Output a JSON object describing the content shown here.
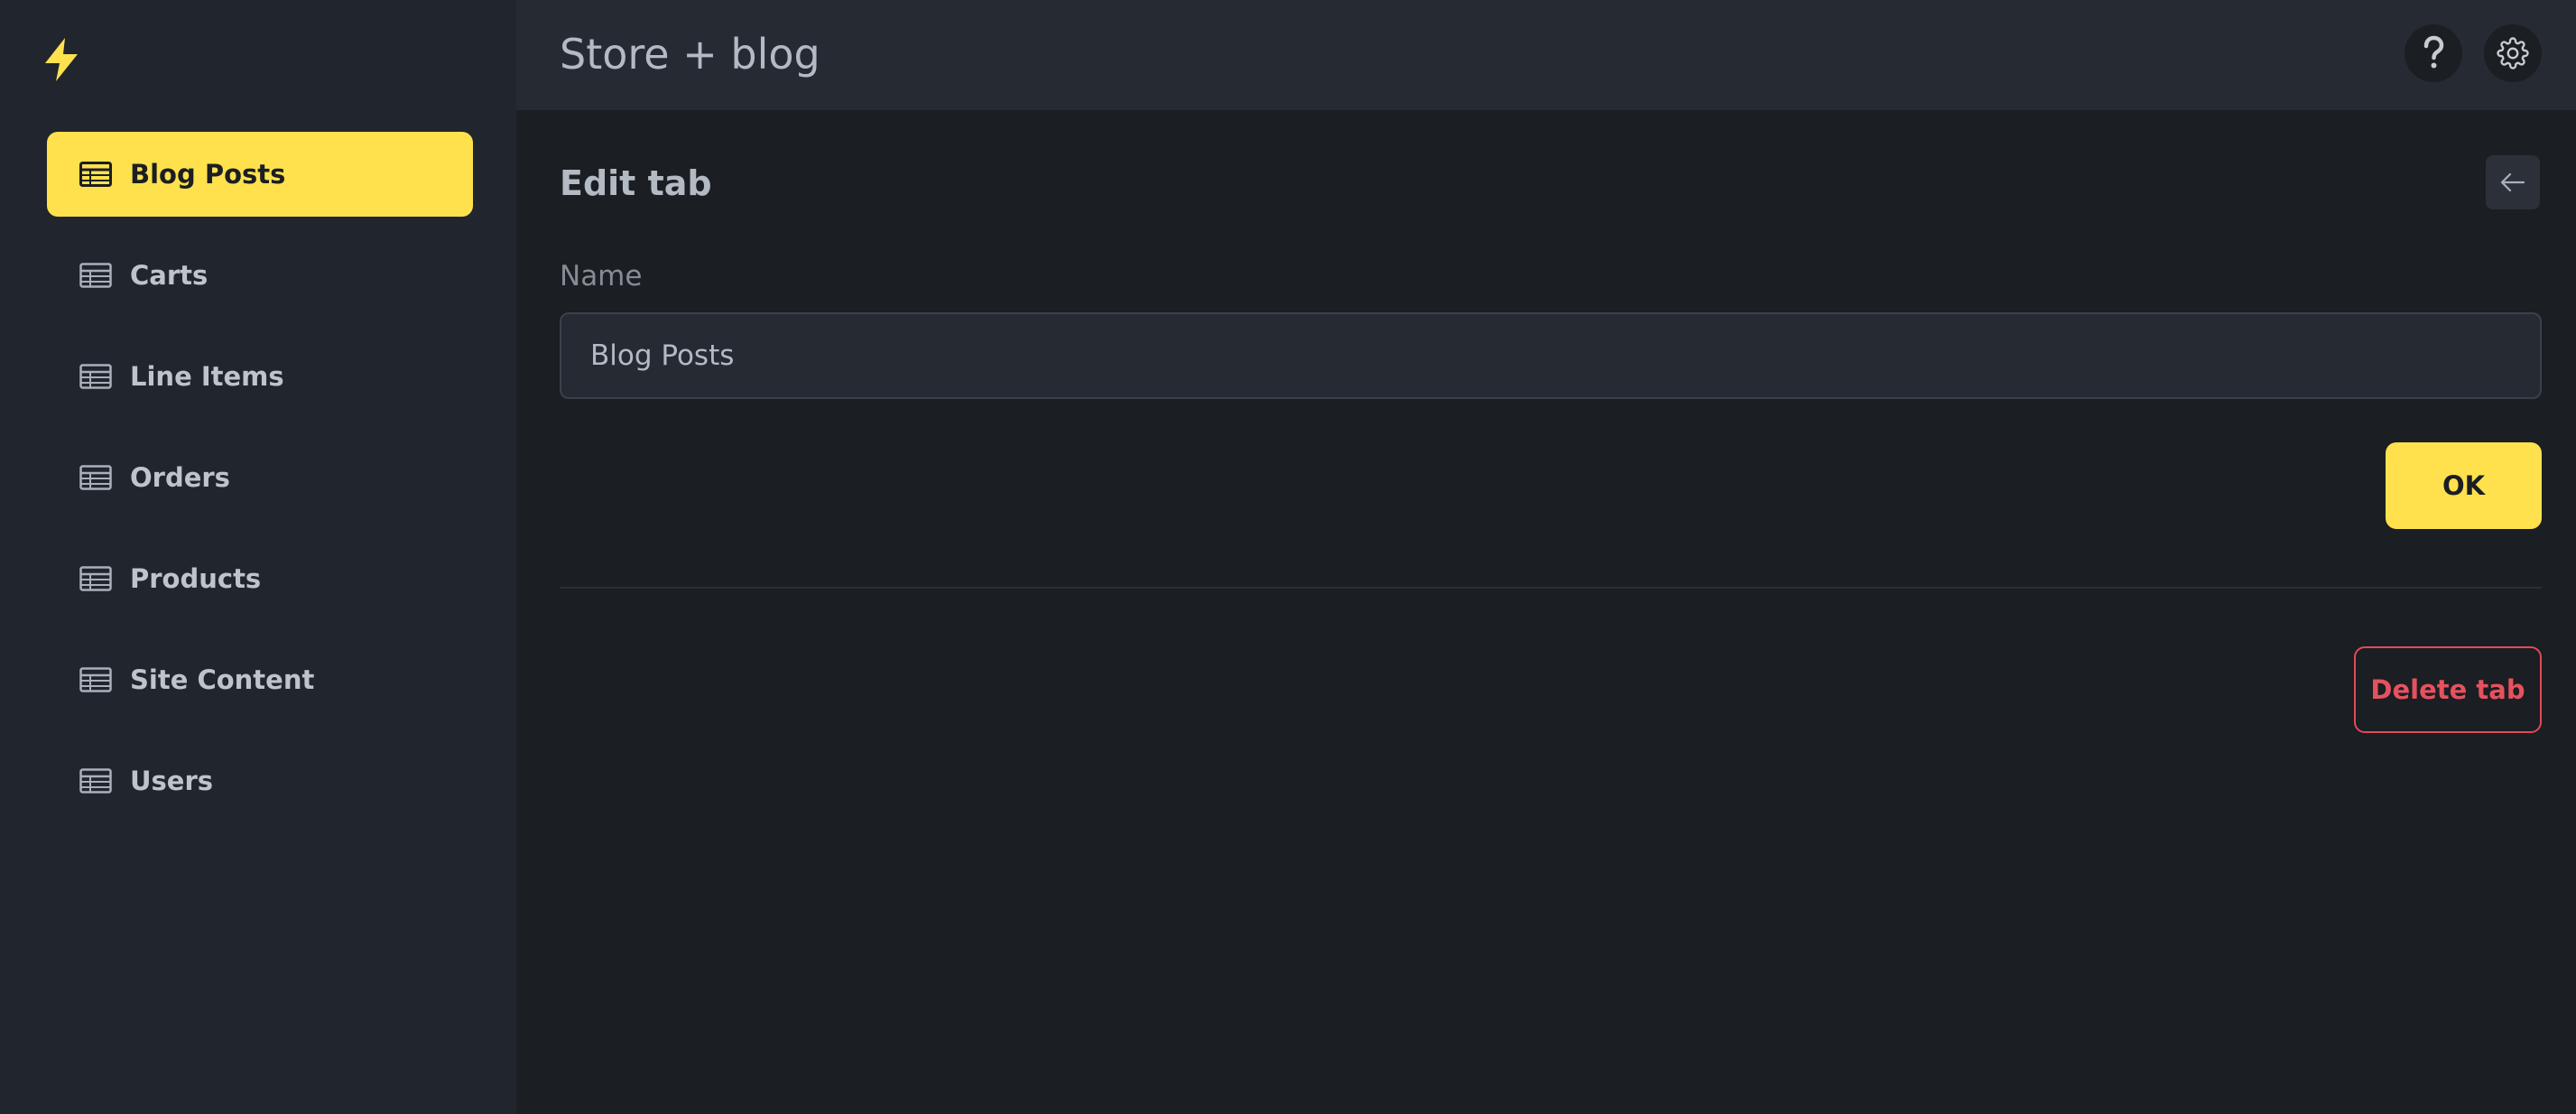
{
  "app": {
    "title": "Store + blog",
    "accent_color": "#ffe14d",
    "danger_color": "#e5525f"
  },
  "sidebar": {
    "logo_icon": "lightning-bolt-icon",
    "items": [
      {
        "label": "Blog Posts",
        "icon": "table-icon",
        "active": true
      },
      {
        "label": "Carts",
        "icon": "table-icon",
        "active": false
      },
      {
        "label": "Line Items",
        "icon": "table-icon",
        "active": false
      },
      {
        "label": "Orders",
        "icon": "table-icon",
        "active": false
      },
      {
        "label": "Products",
        "icon": "table-icon",
        "active": false
      },
      {
        "label": "Site Content",
        "icon": "table-icon",
        "active": false
      },
      {
        "label": "Users",
        "icon": "table-icon",
        "active": false
      }
    ]
  },
  "header": {
    "help_icon": "question-mark-icon",
    "settings_icon": "gear-icon"
  },
  "edit_tab": {
    "title": "Edit tab",
    "back_icon": "arrow-left-icon",
    "name_label": "Name",
    "name_value": "Blog Posts",
    "ok_label": "OK",
    "delete_label": "Delete tab"
  }
}
